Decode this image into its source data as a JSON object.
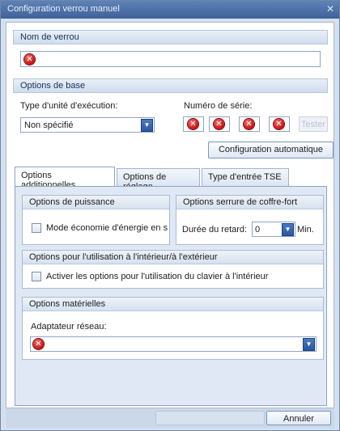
{
  "window": {
    "title": "Configuration verrou manuel",
    "close_glyph": "✕"
  },
  "lock_name": {
    "header": "Nom de verrou",
    "value": ""
  },
  "base_options": {
    "header": "Options de base",
    "unit_type_label": "Type d'unité d'exécution:",
    "unit_type_value": "Non spécifié",
    "serial_label": "Numéro de série:",
    "serial_fields": [
      "",
      "",
      "",
      ""
    ],
    "serial_side_button": "Tester",
    "auto_config_button": "Configuration automatique"
  },
  "tabs": [
    {
      "label": "Options additionnelles",
      "active": true
    },
    {
      "label": "Options de réglage",
      "active": false
    },
    {
      "label": "Type d'entrée TSE",
      "active": false
    }
  ],
  "power_options": {
    "header": "Options de puissance",
    "checkbox_label": "Mode économie d'énergie en s",
    "checked": false
  },
  "safe_lock_options": {
    "header": "Options serrure de coffre-fort",
    "delay_label": "Durée du retard:",
    "delay_value": "0",
    "delay_unit": "Min."
  },
  "indoor_outdoor": {
    "header": "Options pour l'utilisation à l'intérieur/à l'extérieur",
    "checkbox_label": "Activer les options pour l'utilisation du clavier à l'intérieur",
    "checked": false
  },
  "hardware_options": {
    "header": "Options matérielles",
    "adapter_label": "Adaptateur réseau:",
    "adapter_value": ""
  },
  "footer": {
    "ok_label": "",
    "cancel_label": "Annuler"
  },
  "colors": {
    "accent": "#3f6198",
    "error": "#c40f0f",
    "panel": "#dfe8f4"
  },
  "icons": {
    "error": "error-icon",
    "dropdown": "chevron-down-icon",
    "close": "close-icon"
  }
}
